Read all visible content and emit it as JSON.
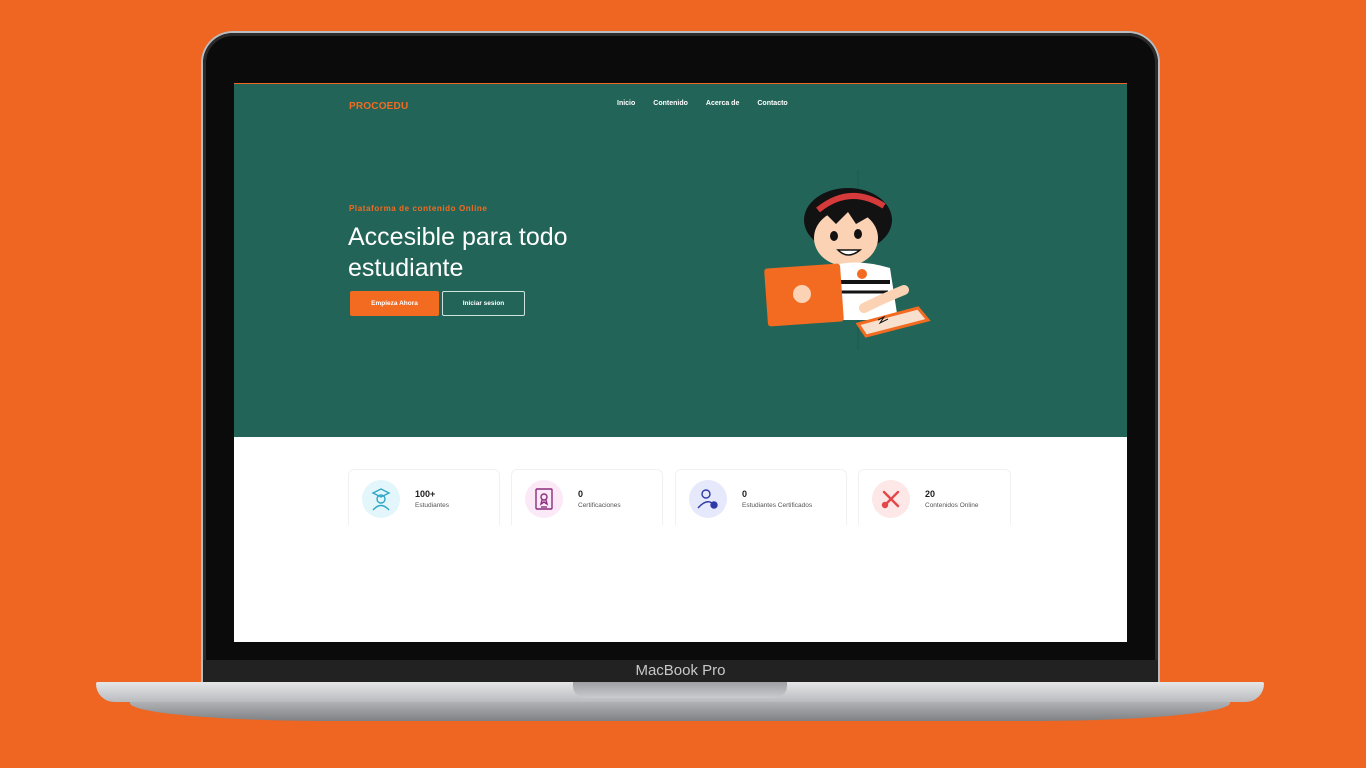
{
  "device": {
    "label": "MacBook Pro"
  },
  "nav": {
    "logo": "PROCOEDU",
    "links": [
      "Inicio",
      "Contenido",
      "Acerca de",
      "Contacto"
    ]
  },
  "hero": {
    "kicker": "Plataforma de contenido Online",
    "headline_line1": "Accesible para todo",
    "headline_line2": "estudiante",
    "cta_primary": "Empieza Ahora",
    "cta_secondary": "Iniciar sesion"
  },
  "stats": [
    {
      "value": "100+",
      "label": "Estudiantes",
      "icon": "graduate-icon",
      "icon_bg": "#e3f6fb",
      "icon_color": "#2fa6c7"
    },
    {
      "value": "0",
      "label": "Certificaciones",
      "icon": "certificate-icon",
      "icon_bg": "#fbe9f7",
      "icon_color": "#8a2d7c"
    },
    {
      "value": "0",
      "label": "Estudiantes Certificados",
      "icon": "certified-user-icon",
      "icon_bg": "#e6e8fb",
      "icon_color": "#2f3aa7"
    },
    {
      "value": "20",
      "label": "Contenidos Online",
      "icon": "tools-icon",
      "icon_bg": "#fde7e7",
      "icon_color": "#e2484b"
    }
  ],
  "colors": {
    "background": "#ee6622",
    "hero": "#236458",
    "accent": "#f26b21"
  }
}
